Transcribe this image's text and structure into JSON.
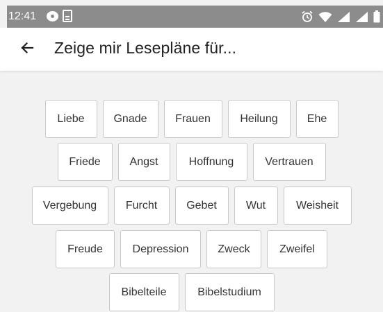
{
  "status_bar": {
    "time": "12:41",
    "icons": [
      "message-icon",
      "document-icon",
      "alarm-icon",
      "wifi-icon",
      "signal-icon",
      "signal-icon",
      "battery-icon"
    ]
  },
  "header": {
    "title": "Zeige mir Lesepläne für...",
    "back_icon": "arrow-left-icon"
  },
  "topics": {
    "rows": [
      [
        "Liebe",
        "Gnade",
        "Frauen",
        "Heilung",
        "Ehe"
      ],
      [
        "Friede",
        "Angst",
        "Hoffnung",
        "Vertrauen"
      ],
      [
        "Vergebung",
        "Furcht",
        "Gebet",
        "Wut",
        "Weisheit"
      ],
      [
        "Freude",
        "Depression",
        "Zweck",
        "Zweifel"
      ],
      [
        "Bibelteile",
        "Bibelstudium"
      ]
    ]
  },
  "colors": {
    "status_bar_bg": "#8c8c8c",
    "app_bar_bg": "#ffffff",
    "content_bg": "#f2f2f2",
    "tag_border": "#c8c8c8",
    "text": "#212121"
  }
}
